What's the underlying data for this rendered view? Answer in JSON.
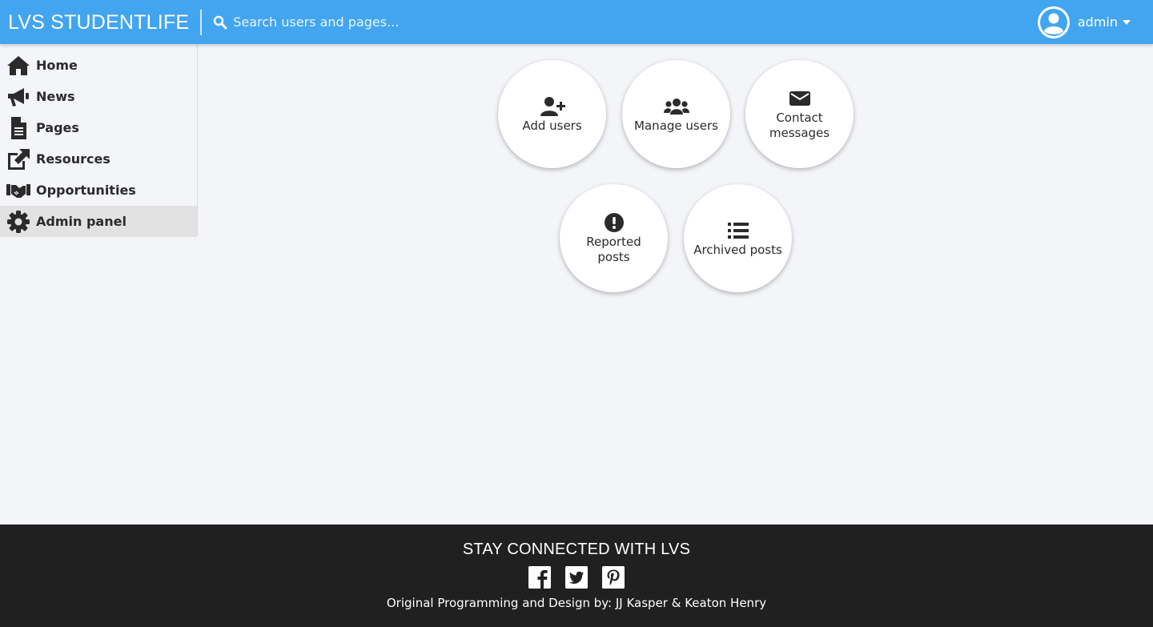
{
  "header": {
    "brand": "LVS STUDENTLIFE",
    "search_placeholder": "Search users and pages...",
    "user_name": "admin",
    "accent_color": "#42a5f0"
  },
  "sidebar": {
    "items": [
      {
        "label": "Home",
        "icon": "home-icon"
      },
      {
        "label": "News",
        "icon": "megaphone-icon"
      },
      {
        "label": "Pages",
        "icon": "file-icon"
      },
      {
        "label": "Resources",
        "icon": "external-link-icon"
      },
      {
        "label": "Opportunities",
        "icon": "handshake-icon"
      },
      {
        "label": "Admin panel",
        "icon": "gear-icon",
        "active": true
      }
    ]
  },
  "admin": {
    "actions": [
      {
        "label": "Add users",
        "icon": "user-plus-icon"
      },
      {
        "label": "Manage users",
        "icon": "users-icon"
      },
      {
        "label": "Contact messages",
        "icon": "envelope-icon"
      },
      {
        "label": "Reported posts",
        "icon": "exclamation-circle-icon"
      },
      {
        "label": "Archived posts",
        "icon": "list-icon"
      }
    ]
  },
  "footer": {
    "title": "STAY CONNECTED WITH LVS",
    "social": [
      "facebook-icon",
      "twitter-icon",
      "pinterest-icon"
    ],
    "credit": "Original Programming and Design by: JJ Kasper & Keaton Henry"
  }
}
